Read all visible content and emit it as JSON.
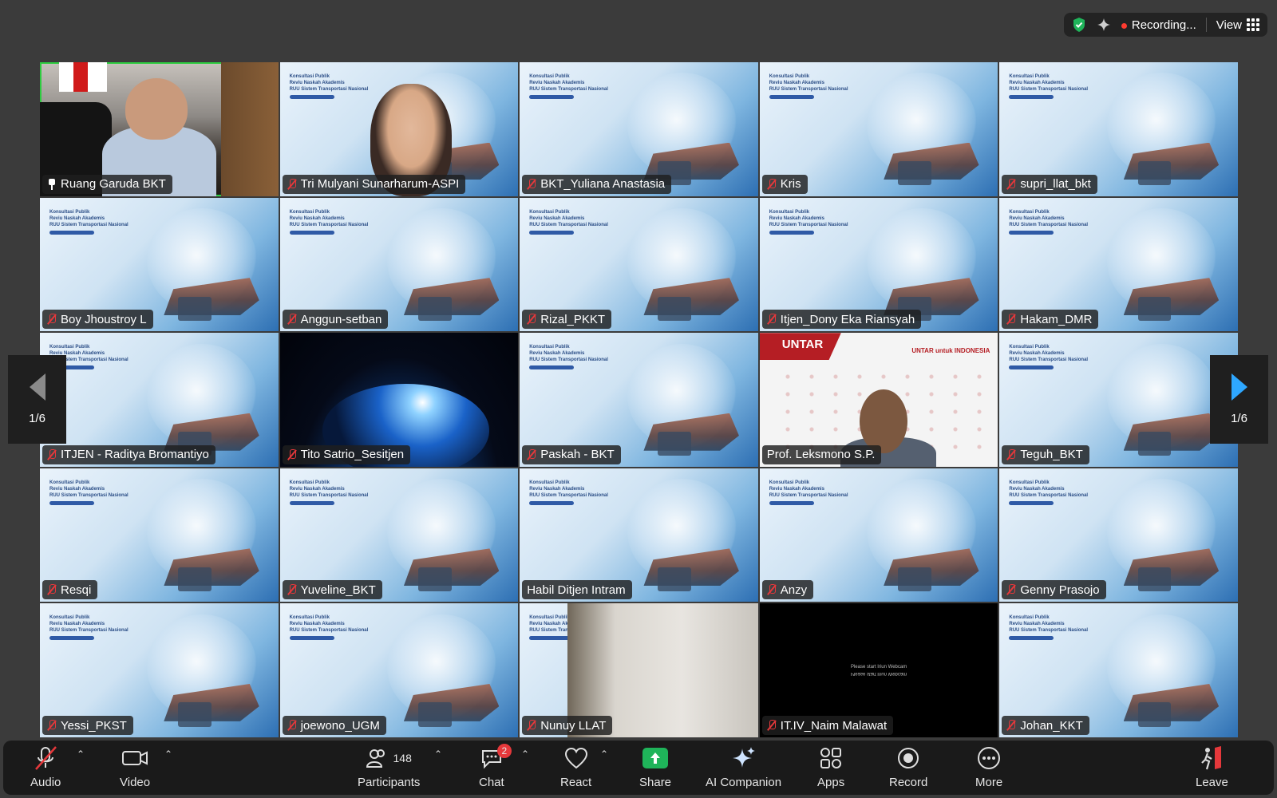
{
  "topbar": {
    "recording": "Recording...",
    "view": "View"
  },
  "pager": {
    "left": "1/6",
    "right": "1/6"
  },
  "bg_slide": {
    "line1": "Konsultasi Publik",
    "line2": "Reviu Naskah Akademis",
    "line3": "RUU Sistem Transportasi Nasional"
  },
  "webcam_msg": {
    "line1": "Please start Iriun Webcam",
    "line2": "Please start Iriun Webcam"
  },
  "untar": {
    "logo": "UNTAR",
    "slogan": "UNTAR untuk INDONESIA"
  },
  "participants": [
    {
      "name": "Ruang Garuda BKT",
      "style": "room",
      "icon": "pin-icon",
      "active": true
    },
    {
      "name": "Tri Mulyani Sunarharum-ASPI",
      "style": "woman",
      "icon": "mic-muted-icon"
    },
    {
      "name": "BKT_Yuliana Anastasia",
      "style": "slide",
      "icon": "mic-muted-icon"
    },
    {
      "name": "Kris",
      "style": "slide",
      "icon": "mic-muted-icon"
    },
    {
      "name": "supri_llat_bkt",
      "style": "slide",
      "icon": "mic-muted-icon"
    },
    {
      "name": "Boy Jhoustroy L",
      "style": "slide",
      "icon": "mic-muted-icon"
    },
    {
      "name": "Anggun-setban",
      "style": "slide",
      "icon": "mic-muted-icon"
    },
    {
      "name": "Rizal_PKKT",
      "style": "slide",
      "icon": "mic-muted-icon"
    },
    {
      "name": "Itjen_Dony Eka Riansyah",
      "style": "slide",
      "icon": "mic-muted-icon"
    },
    {
      "name": "Hakam_DMR",
      "style": "slide",
      "icon": "mic-muted-icon"
    },
    {
      "name": "ITJEN - Raditya Bromantiyo",
      "style": "slide",
      "icon": "mic-muted-icon"
    },
    {
      "name": "Tito Satrio_Sesitjen",
      "style": "space",
      "icon": "mic-muted-icon"
    },
    {
      "name": "Paskah - BKT",
      "style": "slide",
      "icon": "mic-muted-icon"
    },
    {
      "name": "Prof. Leksmono S.P.",
      "style": "untar",
      "icon": ""
    },
    {
      "name": "Teguh_BKT",
      "style": "slide",
      "icon": "mic-muted-icon"
    },
    {
      "name": "Resqi",
      "style": "slide",
      "icon": "mic-muted-icon"
    },
    {
      "name": "Yuveline_BKT",
      "style": "slide",
      "icon": "mic-muted-icon"
    },
    {
      "name": "Habil Ditjen Intram",
      "style": "slide",
      "icon": ""
    },
    {
      "name": "Anzy",
      "style": "slide",
      "icon": "mic-muted-icon"
    },
    {
      "name": "Genny Prasojo",
      "style": "slide",
      "icon": "mic-muted-icon"
    },
    {
      "name": "Yessi_PKST",
      "style": "slide",
      "icon": "mic-muted-icon"
    },
    {
      "name": "joewono_UGM",
      "style": "slide",
      "icon": "mic-muted-icon"
    },
    {
      "name": "Nunuy LLAT",
      "style": "blurry",
      "icon": "mic-muted-icon"
    },
    {
      "name": "IT.IV_Naim Malawat",
      "style": "webcam",
      "icon": "mic-muted-icon"
    },
    {
      "name": "Johan_KKT",
      "style": "slide",
      "icon": "mic-muted-icon"
    }
  ],
  "toolbar": {
    "audio": "Audio",
    "video": "Video",
    "participants": "Participants",
    "participants_count": "148",
    "chat": "Chat",
    "chat_badge": "2",
    "react": "React",
    "share": "Share",
    "ai_companion": "AI Companion",
    "apps": "Apps",
    "record": "Record",
    "more": "More",
    "leave": "Leave"
  },
  "colors": {
    "active_border": "#2ecc40",
    "muted_red": "#e5383b",
    "share_green": "#1fb45a",
    "pager_blue": "#2ea7ff"
  }
}
